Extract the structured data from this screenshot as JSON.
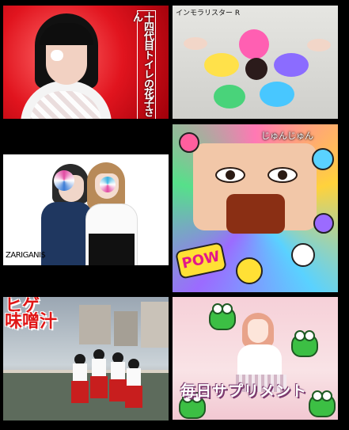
{
  "tiles": [
    {
      "id": "t1",
      "vertical_title": "十四代目トイレの花子さん"
    },
    {
      "id": "t2",
      "title": "インモラリスター R"
    },
    {
      "id": "t3",
      "label": "ZARIGANI$"
    },
    {
      "id": "t4",
      "name": "じゅんじゅん",
      "pow": "POW"
    },
    {
      "id": "t5",
      "logo": "ヒゲ 味噌汁"
    },
    {
      "id": "t6",
      "title": "毎日サプリメント"
    }
  ]
}
